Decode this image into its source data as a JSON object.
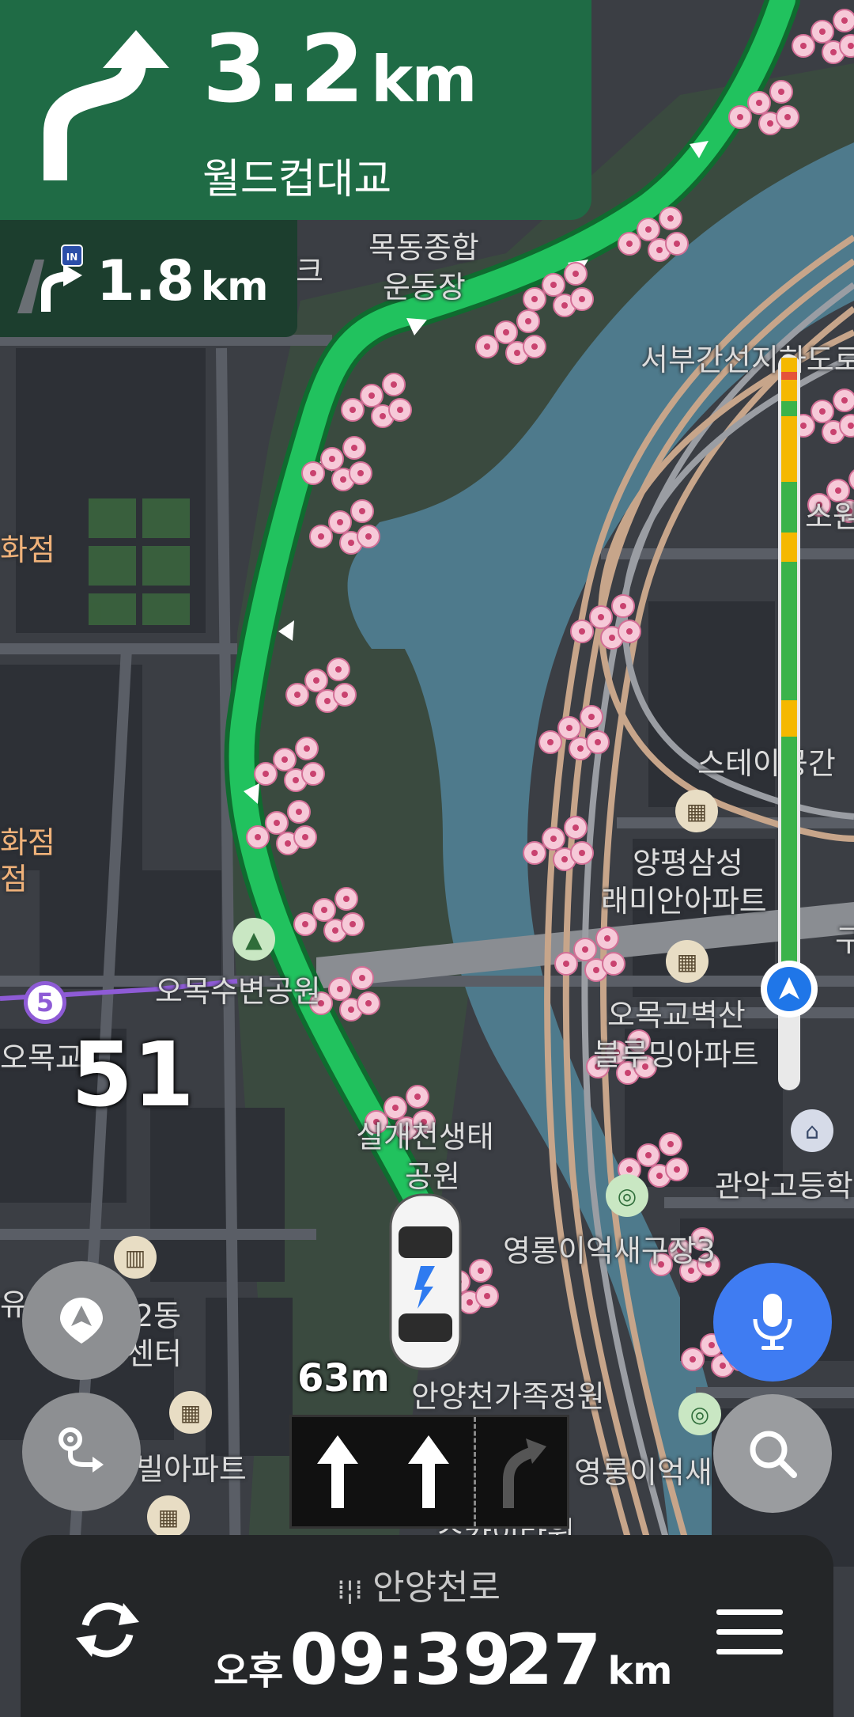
{
  "guidance": {
    "distance": "3.2",
    "unit": "km",
    "road": "월드컵대교"
  },
  "next_guidance": {
    "distance": "1.8",
    "unit": "km",
    "shield": "IN"
  },
  "map_labels": {
    "stadium_1": "목동종합",
    "stadium_2": "운동장",
    "seobu": "서부간선지하도로",
    "sowon": "소원",
    "dept_store_1": "화점",
    "dept_store_2": "화점",
    "dept_store_3": "점",
    "stage": "스테이공간",
    "yangpyeong_1": "양평삼성",
    "yangpyeong_2": "래미안아파트",
    "gu": "구",
    "omok_park": "오목수변공원",
    "omok_station": "오목교",
    "omokgyo_1": "오목교벽산",
    "omokgyo_2": "블루밍아파트",
    "silgae_1": "실개천생태",
    "silgae_2": "공원",
    "gwanak": "관악고등학",
    "yeongnong_1": "영롱이억새구장3",
    "dong_1": "2동",
    "dong_2": "센터",
    "yu": "유",
    "family_garden": "안양천가족정원",
    "yeongnong_2": "영롱이억새",
    "village": "빌아파트",
    "sky_tower": "스카이타워",
    "ring_road": "크"
  },
  "subway_line": "5",
  "speed_limit": "51",
  "lane_distance": "63m",
  "bottom": {
    "current_road": "안양천로",
    "ampm": "오후",
    "arrival_time": "09:39",
    "remaining": "27",
    "remaining_unit": "km"
  },
  "colors": {
    "guide_green": "#1f6b45",
    "route_green": "#21c25e",
    "mic_blue": "#3f7cf2"
  },
  "traffic_bar": {
    "segments": [
      {
        "color": "#f5b800",
        "frac": 0.02
      },
      {
        "color": "#e5533a",
        "frac": 0.01
      },
      {
        "color": "#f5b800",
        "frac": 0.03
      },
      {
        "color": "#3bb34a",
        "frac": 0.02
      },
      {
        "color": "#f5b800",
        "frac": 0.09
      },
      {
        "color": "#3bb34a",
        "frac": 0.07
      },
      {
        "color": "#f5b800",
        "frac": 0.04
      },
      {
        "color": "#3bb34a",
        "frac": 0.19
      },
      {
        "color": "#f5b800",
        "frac": 0.05
      },
      {
        "color": "#3bb34a",
        "frac": 0.36
      },
      {
        "color": "#e9e9e9",
        "frac": 0.12
      }
    ]
  }
}
